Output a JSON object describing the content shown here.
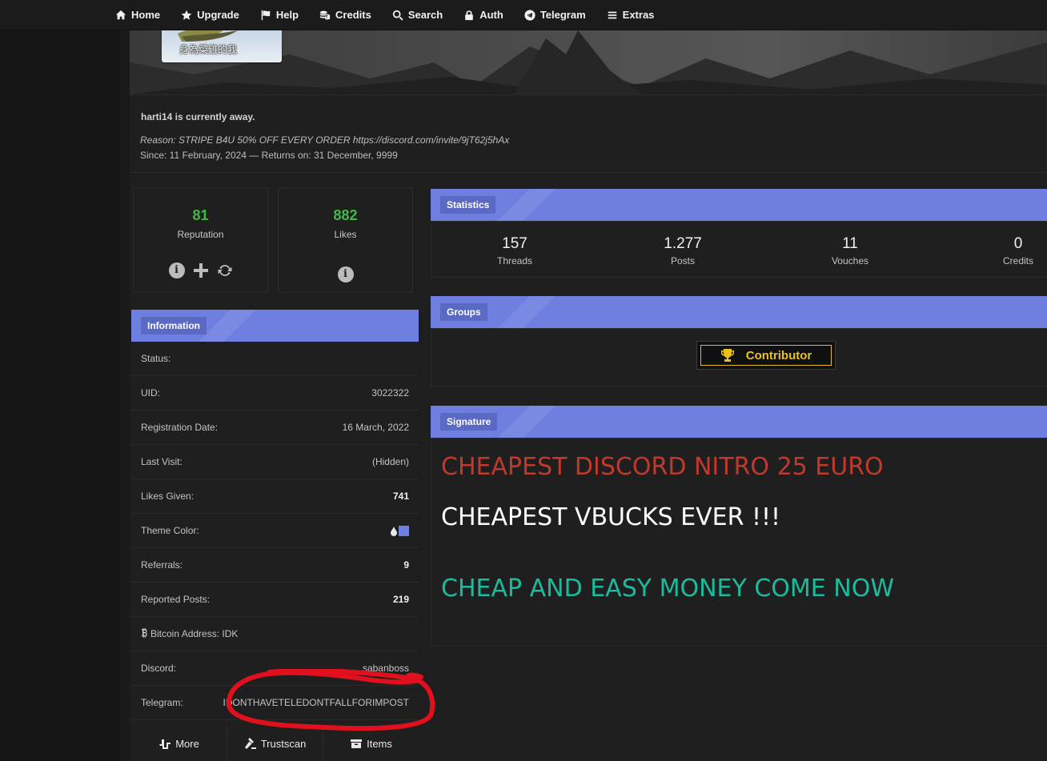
{
  "nav": {
    "items": [
      {
        "label": "Home",
        "icon": "home-icon"
      },
      {
        "label": "Upgrade",
        "icon": "star-icon"
      },
      {
        "label": "Help",
        "icon": "flag-icon"
      },
      {
        "label": "Credits",
        "icon": "coins-icon"
      },
      {
        "label": "Search",
        "icon": "search-icon"
      },
      {
        "label": "Auth",
        "icon": "lock-icon"
      },
      {
        "label": "Telegram",
        "icon": "telegram-icon"
      },
      {
        "label": "Extras",
        "icon": "menu-icon"
      }
    ]
  },
  "banner": {
    "userbar_text": "身為菜雞的我"
  },
  "away": {
    "title": "harti14 is currently away.",
    "reason": "Reason: STRIPE B4U 50% OFF EVERY ORDER https://discord.com/invite/9jT62j5hAx",
    "since": "Since: 11 February, 2024 — Returns on: 31 December, 9999"
  },
  "reputation": {
    "value": "81",
    "label": "Reputation"
  },
  "likes": {
    "value": "882",
    "label": "Likes"
  },
  "information": {
    "header": "Information",
    "rows": [
      {
        "key": "Status:",
        "value": ""
      },
      {
        "key": "UID:",
        "value": "3022322"
      },
      {
        "key": "Registration Date:",
        "value": "16 March, 2022"
      },
      {
        "key": "Last Visit:",
        "value": "(Hidden)"
      },
      {
        "key": "Likes Given:",
        "value": "741"
      },
      {
        "key": "Theme Color:",
        "value": ""
      },
      {
        "key": "Referrals:",
        "value": "9"
      },
      {
        "key": "Reported Posts:",
        "value": "219"
      },
      {
        "key": "Bitcoin Address: IDK",
        "value": ""
      },
      {
        "key": "Discord:",
        "value": "sabanboss"
      },
      {
        "key": "Telegram:",
        "value": "IDONTHAVETELEDONTFALLFORIMPOST"
      }
    ],
    "theme_color": "#6f7fe0",
    "buttons": {
      "more": "More",
      "trustscan": "Trustscan",
      "items": "Items"
    }
  },
  "statistics": {
    "header": "Statistics",
    "stats": [
      {
        "value": "157",
        "label": "Threads"
      },
      {
        "value": "1.277",
        "label": "Posts"
      },
      {
        "value": "11",
        "label": "Vouches"
      },
      {
        "value": "0",
        "label": "Credits"
      }
    ]
  },
  "groups": {
    "header": "Groups",
    "badge": "Contributor"
  },
  "signature": {
    "header": "Signature",
    "line1": "CHEAPEST DISCORD NITRO 25 EURO",
    "line2": "CHEAPEST VBUCKS EVER !!!",
    "line3": "CHEAP AND EASY MONEY COME NOW"
  },
  "colors": {
    "accent": "#6f7fe0",
    "rep_green": "#3dbd3d",
    "sig_red": "#c0392b",
    "sig_green": "#1abc9c",
    "badge_gold": "#e8c21c",
    "annotation_red": "#e0101e"
  }
}
